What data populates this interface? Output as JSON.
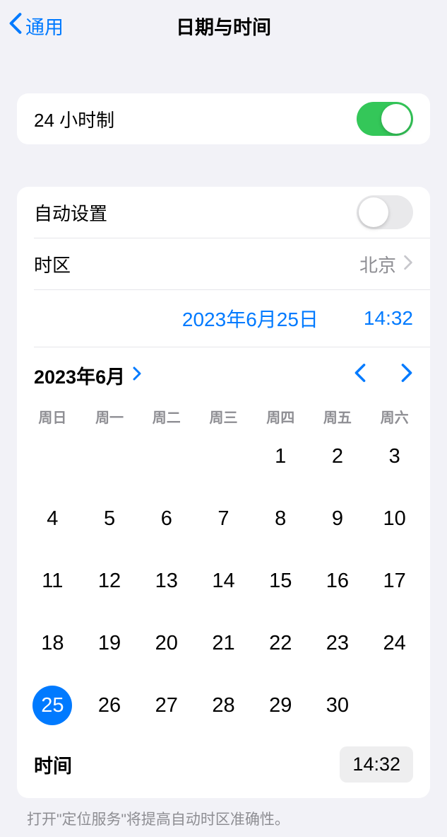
{
  "header": {
    "back_label": "通用",
    "title": "日期与时间"
  },
  "settings": {
    "twentyfour_hour_label": "24 小时制",
    "auto_set_label": "自动设置",
    "timezone_label": "时区",
    "timezone_value": "北京"
  },
  "datetime": {
    "date_display": "2023年6月25日",
    "time_display": "14:32"
  },
  "calendar": {
    "month_label": "2023年6月",
    "weekdays": [
      "周日",
      "周一",
      "周二",
      "周三",
      "周四",
      "周五",
      "周六"
    ],
    "days": [
      null,
      null,
      null,
      null,
      1,
      2,
      3,
      4,
      5,
      6,
      7,
      8,
      9,
      10,
      11,
      12,
      13,
      14,
      15,
      16,
      17,
      18,
      19,
      20,
      21,
      22,
      23,
      24,
      25,
      26,
      27,
      28,
      29,
      30,
      null
    ],
    "selected_day": 25
  },
  "time_row": {
    "label": "时间",
    "value": "14:32"
  },
  "footer": {
    "note": "打开\"定位服务\"将提高自动时区准确性。"
  }
}
